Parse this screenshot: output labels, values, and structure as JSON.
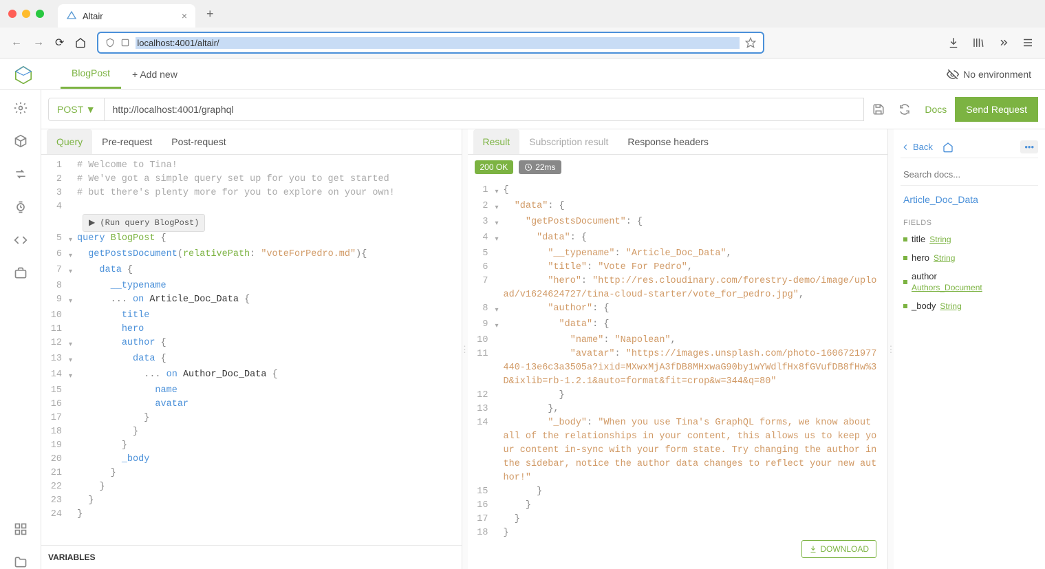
{
  "browser": {
    "tab_title": "Altair",
    "url": "localhost:4001/altair/"
  },
  "app": {
    "active_tab": "BlogPost",
    "add_tab": "+ Add new",
    "no_environment": "No environment"
  },
  "request": {
    "method": "POST ▼",
    "endpoint": "http://localhost:4001/graphql",
    "docs_label": "Docs",
    "send_label": "Send Request"
  },
  "query_panel": {
    "tabs": [
      "Query",
      "Pre-request",
      "Post-request"
    ],
    "run_label": "▶ (Run query BlogPost)",
    "variables_label": "VARIABLES",
    "lines": {
      "l1": "# Welcome to Tina!",
      "l2": "# We've got a simple query set up for you to get started",
      "l3": "# but there's plenty more for you to explore on your own!",
      "q_keyword": "query",
      "q_name": "BlogPost",
      "doc_fn": "getPostsDocument",
      "arg_name": "relativePath",
      "arg_val": "\"voteForPedro.md\"",
      "typename": "__typename",
      "on_article": "Article_Doc_Data",
      "title": "title",
      "hero": "hero",
      "author": "author",
      "data": "data",
      "on_author": "Author_Doc_Data",
      "name": "name",
      "avatar": "avatar",
      "body": "_body"
    }
  },
  "result_panel": {
    "tabs": [
      "Result",
      "Subscription result",
      "Response headers"
    ],
    "status": "200 OK",
    "time": "22ms",
    "download": "DOWNLOAD",
    "json": {
      "k_data": "\"data\"",
      "k_getPosts": "\"getPostsDocument\"",
      "k_data2": "\"data\"",
      "k_typename": "\"__typename\"",
      "v_typename": "\"Article_Doc_Data\"",
      "k_title": "\"title\"",
      "v_title": "\"Vote For Pedro\"",
      "k_hero": "\"hero\"",
      "v_hero": "\"http://res.cloudinary.com/forestry-demo/image/upload/v1624624727/tina-cloud-starter/vote_for_pedro.jpg\"",
      "k_author": "\"author\"",
      "k_name": "\"name\"",
      "v_name": "\"Napolean\"",
      "k_avatar": "\"avatar\"",
      "v_avatar": "\"https://images.unsplash.com/photo-1606721977440-13e6c3a3505a?ixid=MXwxMjA3fDB8MHxwaG90by1wYWdlfHx8fGVufDB8fHw%3D&ixlib=rb-1.2.1&auto=format&fit=crop&w=344&q=80\"",
      "k_body": "\"_body\"",
      "v_body": "\"When you use Tina's GraphQL forms, we know about all of the relationships in your content, this allows us to keep your content in-sync with your form state. Try changing the author in the sidebar, notice the author data changes to reflect your new author!\""
    }
  },
  "docs": {
    "back": "Back",
    "search_placeholder": "Search docs...",
    "type_name": "Article_Doc_Data",
    "fields_label": "FIELDS",
    "fields": [
      {
        "name": "title",
        "type": "String"
      },
      {
        "name": "hero",
        "type": "String"
      },
      {
        "name": "author",
        "type": "Authors_Document"
      },
      {
        "name": "_body",
        "type": "String"
      }
    ]
  }
}
